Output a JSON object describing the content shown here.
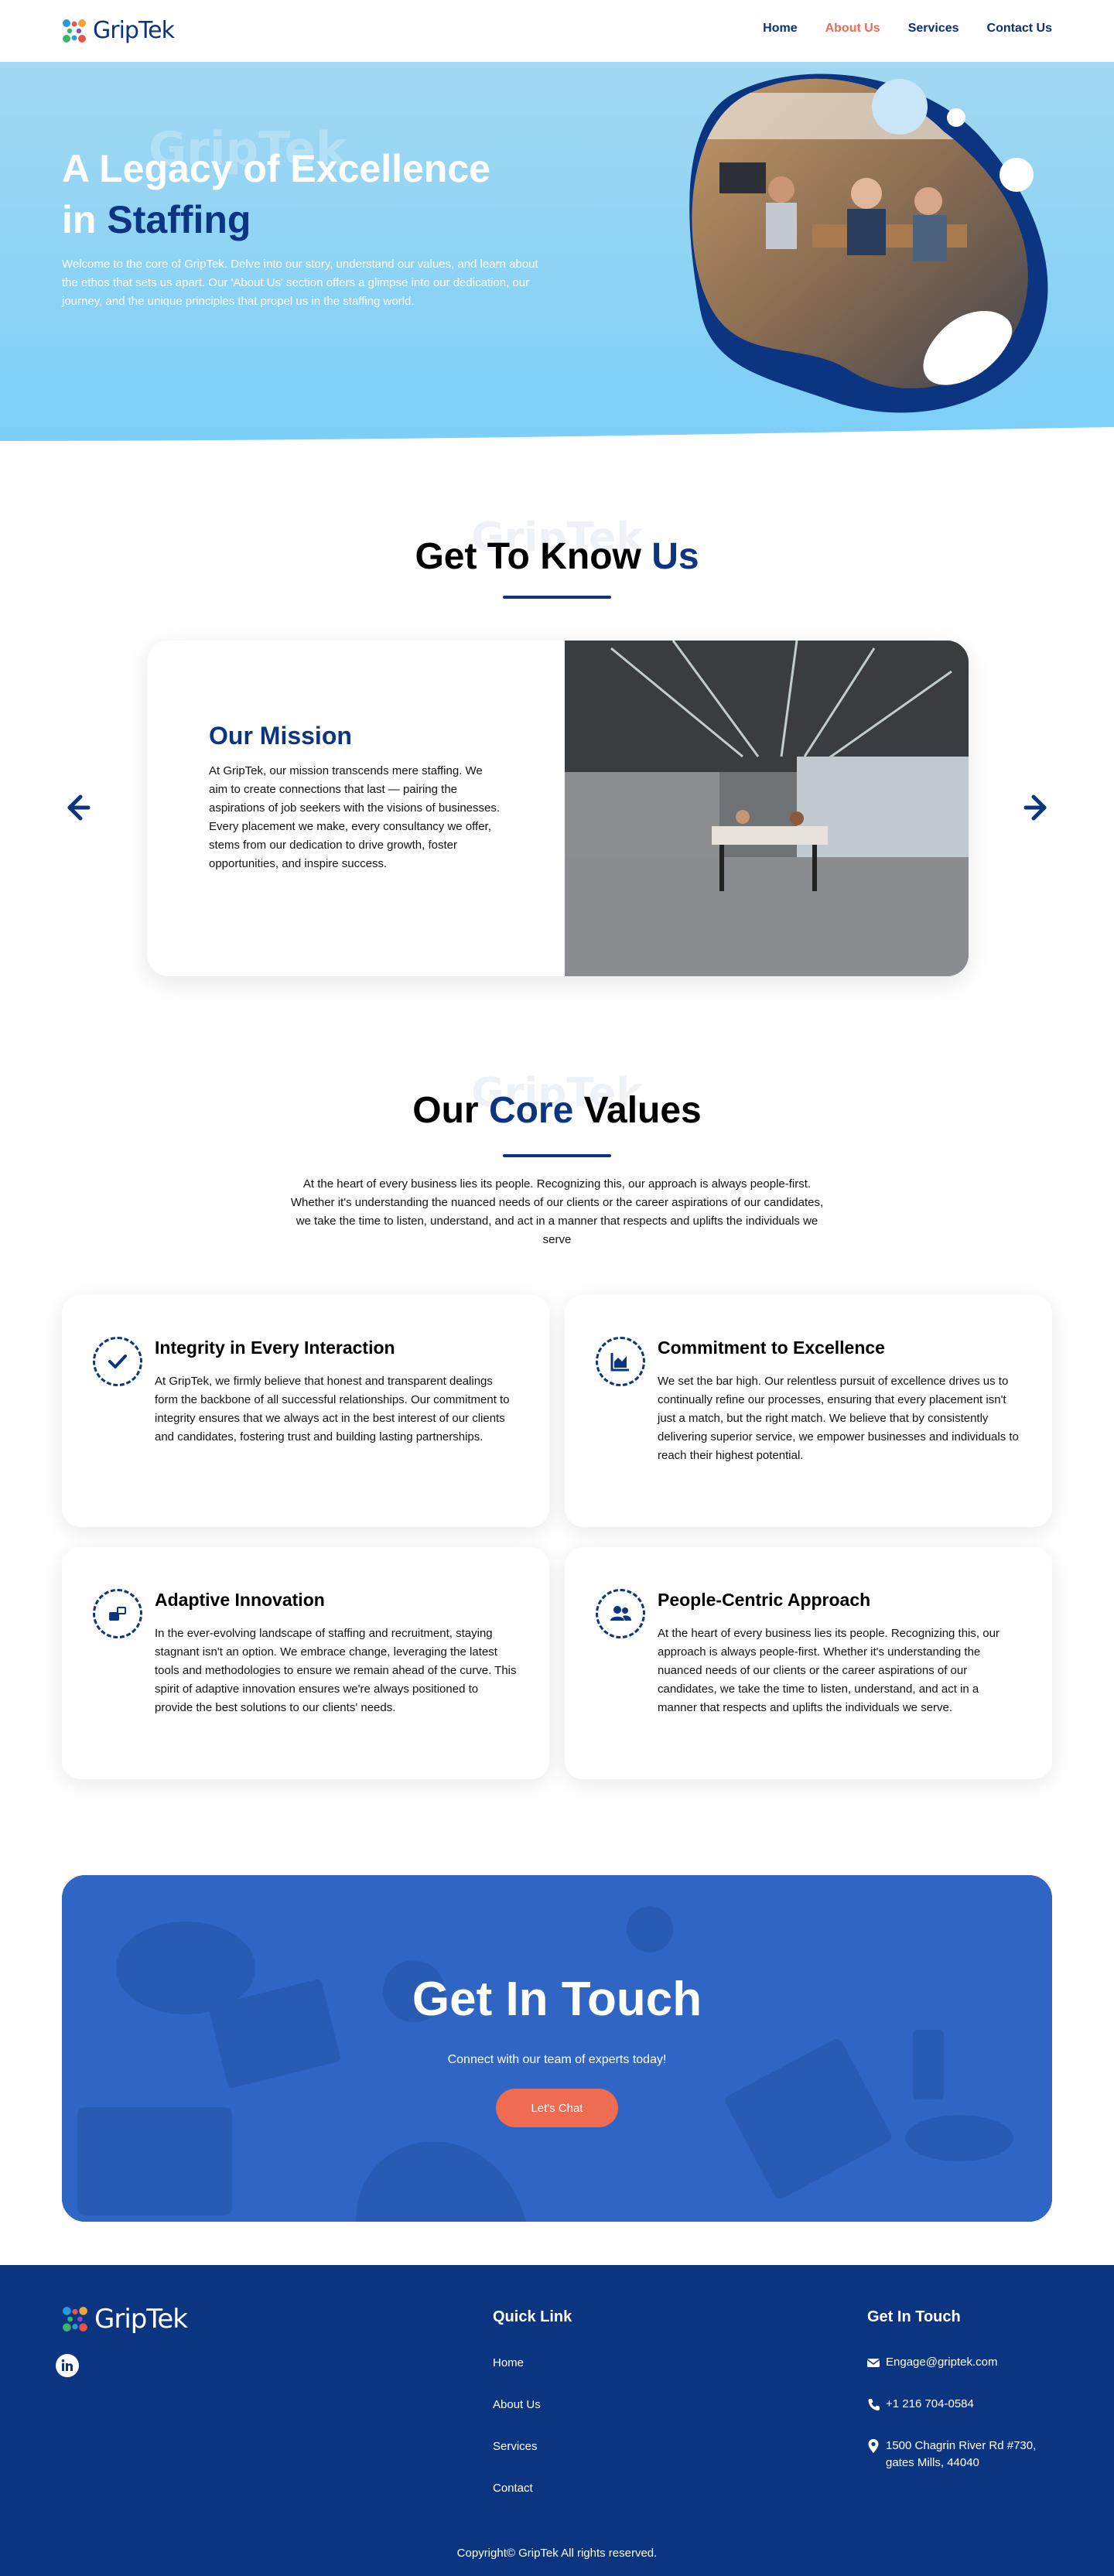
{
  "brand": {
    "name": "GripTek",
    "colors": {
      "navy": "#0b3580",
      "coral": "#ef6b52",
      "sky": "#8fd0f5",
      "cta_blue": "#2f66c6"
    }
  },
  "nav": {
    "items": [
      {
        "label": "Home",
        "active": false
      },
      {
        "label": "About Us",
        "active": true
      },
      {
        "label": "Services",
        "active": false
      },
      {
        "label": "Contact Us",
        "active": false
      }
    ]
  },
  "hero": {
    "watermark": "GripTek",
    "title_line1": "A Legacy of Excellence",
    "title_in": "in",
    "title_accent": "Staffing",
    "text": "Welcome to the core of GripTek. Delve into our story, understand our values, and learn about the ethos that sets us apart. Our 'About Us' section offers a glimpse into our dedication, our journey, and the unique principles that propel us in the staffing world."
  },
  "about": {
    "watermark": "GripTek",
    "title_main": "Get To Know",
    "title_accent": "Us",
    "slide": {
      "title": "Our Mission",
      "text": "At GripTek, our mission transcends mere staffing. We aim to create connections that last — pairing the aspirations of job seekers with the visions of businesses. Every placement we make, every consultancy we offer, stems from our dedication to drive growth, foster opportunities, and inspire success."
    },
    "prev_icon": "arrow-left-icon",
    "next_icon": "arrow-right-icon"
  },
  "values": {
    "watermark": "GripTek",
    "title_pre": "Our",
    "title_accent": "Core",
    "title_post": "Values",
    "intro": "At the heart of every business lies its people. Recognizing this, our approach is always people-first. Whether it's understanding the nuanced needs of our clients or the career aspirations of our candidates, we take the time to listen, understand, and act in a manner that respects and uplifts the individuals we serve",
    "cards": [
      {
        "icon": "check-icon",
        "title": "Integrity in Every Interaction",
        "text": "At GripTek, we firmly believe that honest and transparent dealings form the backbone of all successful relationships. Our commitment to integrity ensures that we always act in the best interest of our clients and candidates, fostering trust and building lasting partnerships."
      },
      {
        "icon": "chart-icon",
        "title": "Commitment to Excellence",
        "text": "We set the bar high. Our relentless pursuit of excellence drives us to continually refine our processes, ensuring that every placement isn't just a match, but the right match. We believe that by consistently delivering superior service, we empower businesses and individuals to reach their highest potential."
      },
      {
        "icon": "innovation-icon",
        "title": "Adaptive Innovation",
        "text": "In the ever-evolving landscape of staffing and recruitment, staying stagnant isn't an option. We embrace change, leveraging the latest tools and methodologies to ensure we remain ahead of the curve. This spirit of adaptive innovation ensures we're always positioned to provide the best solutions to our clients' needs."
      },
      {
        "icon": "people-icon",
        "title": "People-Centric Approach",
        "text": "At the heart of every business lies its people. Recognizing this, our approach is always people-first. Whether it's understanding the nuanced needs of our clients or the career aspirations of our candidates, we take the time to listen, understand, and act in a manner that respects and uplifts the individuals we serve."
      }
    ]
  },
  "cta": {
    "title": "Get In Touch",
    "subtitle": "Connect with our team of experts today!",
    "button": "Let's Chat"
  },
  "footer": {
    "quick_title": "Quick Link",
    "links": [
      "Home",
      "About Us",
      "Services",
      "Contact"
    ],
    "touch_title": "Get In Touch",
    "email": "Engage@griptek.com",
    "phone": "+1 216 704-0584",
    "address_line1": "1500 Chagrin River Rd #730,",
    "address_line2": "gates Mills, 44040",
    "social": "linkedin-icon",
    "copyright": "Copyright© GripTek All rights reserved."
  }
}
